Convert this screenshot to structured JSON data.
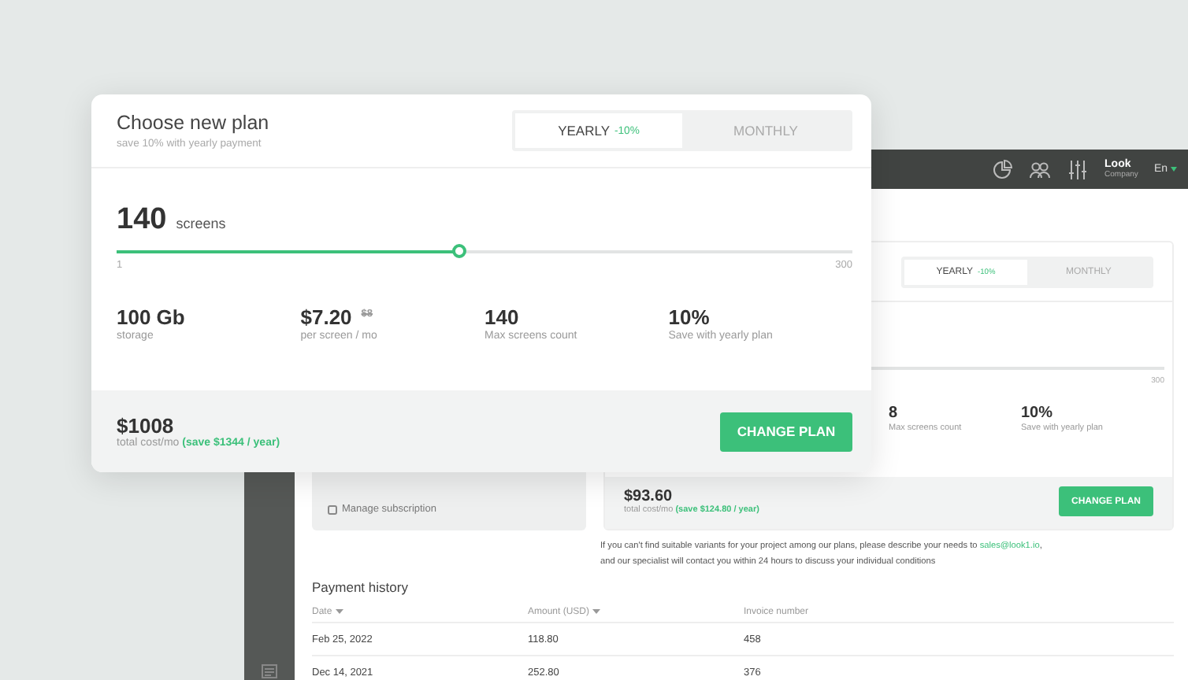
{
  "app": {
    "header": {
      "user_name": "Look",
      "user_role": "Company",
      "language": "En"
    },
    "subscription": {
      "link": "Manage subscription"
    },
    "plan_panel": {
      "tabs": [
        {
          "label": "YEARLY",
          "badge": "-10%",
          "selected": true
        },
        {
          "label": "MONTHLY",
          "selected": false
        }
      ],
      "slider": {
        "level": 0.027,
        "max": "300"
      },
      "stats": [
        {
          "value": "8",
          "label": "Max screens count"
        },
        {
          "value": "10%",
          "label": "Save with yearly plan"
        }
      ],
      "total": {
        "amount": "$93.60",
        "label": "total cost/mo",
        "saving": "(save $124.80 / year)"
      },
      "button": "CHANGE PLAN"
    },
    "note": {
      "text": "If you can't find suitable variants for your project among our plans, please describe your needs to",
      "link": "sales@look1.io",
      "link_suffix": ",",
      "text_after": "and our specialist will contact you within 24 hours to discuss your individual conditions"
    },
    "payment_history": {
      "title": "Payment history",
      "columns": [
        {
          "label": "Date",
          "sortable": true
        },
        {
          "label": "Amount (USD)",
          "sortable": true
        },
        {
          "label": "Invoice number",
          "sortable": false
        }
      ],
      "rows": [
        [
          "Feb 25, 2022",
          "118.80",
          "458"
        ],
        [
          "Dec 14, 2021",
          "252.80",
          "376"
        ]
      ]
    }
  },
  "plan_dialog": {
    "title": "Choose new plan",
    "subtitle": "save 10% with yearly payment",
    "tabs": [
      {
        "label": "YEARLY",
        "badge": "-10%",
        "selected": true
      },
      {
        "label": "MONTHLY",
        "selected": false
      }
    ],
    "slider": {
      "value": "140",
      "unit": "screens",
      "level": 0.465,
      "min": "1",
      "max": "300"
    },
    "stats": [
      {
        "value": "100 Gb",
        "label": "storage"
      },
      {
        "value": "$7.20",
        "old_value": "$8",
        "label": "per screen / mo"
      },
      {
        "value": "140",
        "label": "Max screens count"
      },
      {
        "value": "10%",
        "label": "Save with yearly plan"
      }
    ],
    "total": {
      "amount": "$1008",
      "label": "total cost/mo",
      "saving": "(save $1344 / year)"
    },
    "button": "CHANGE PLAN"
  }
}
